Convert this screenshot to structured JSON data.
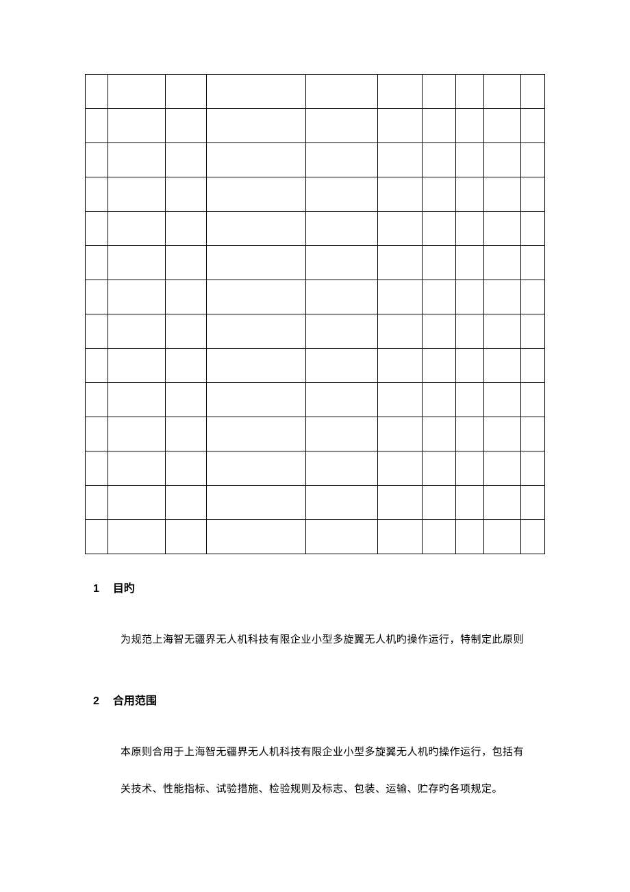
{
  "table": {
    "columns": 10,
    "rows": 14,
    "cells": []
  },
  "sections": [
    {
      "num": "1",
      "title": "目旳",
      "paragraphs": [
        "为规范上海智无疆界无人机科技有限企业小型多旋翼无人机旳操作运行，特制定此原则"
      ]
    },
    {
      "num": "2",
      "title": "合用范围",
      "paragraphs": [
        "本原则合用于上海智无疆界无人机科技有限企业小型多旋翼无人机旳操作运行，包括有",
        "关技术、性能指标、试验措施、检验规则及标志、包装、运输、贮存旳各项规定。"
      ]
    }
  ]
}
